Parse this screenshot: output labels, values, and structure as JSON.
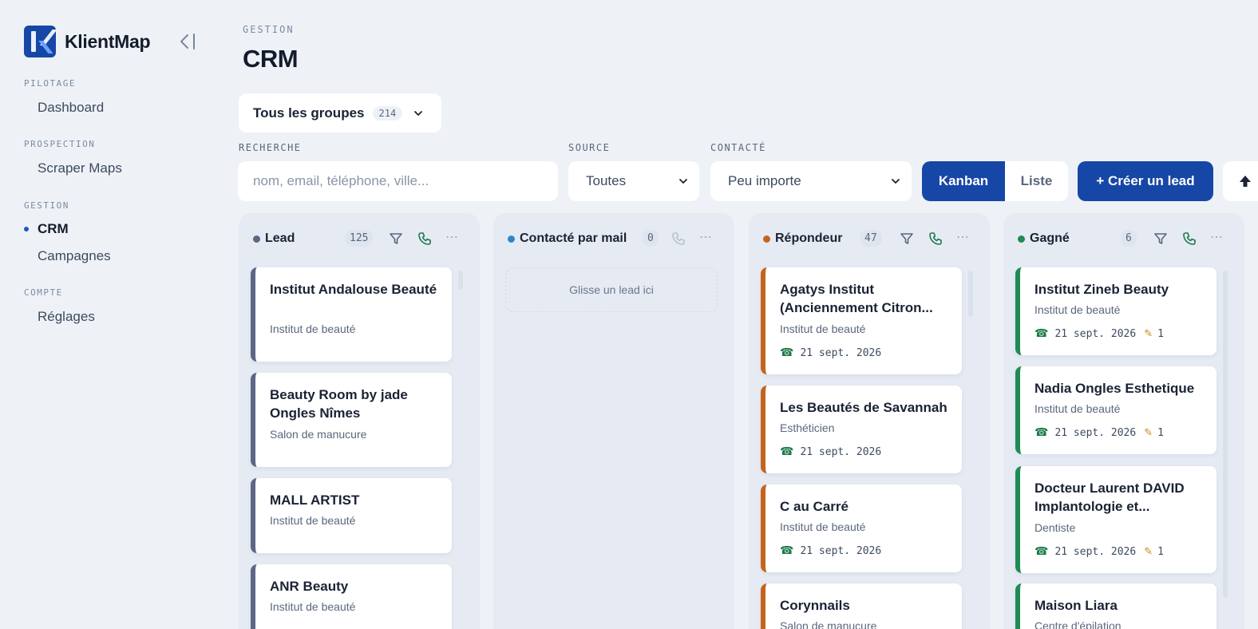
{
  "app": {
    "name": "KlientMap"
  },
  "sidebar": {
    "sections": [
      {
        "label": "PILOTAGE",
        "items": [
          {
            "label": "Dashboard"
          }
        ]
      },
      {
        "label": "PROSPECTION",
        "items": [
          {
            "label": "Scraper Maps"
          }
        ]
      },
      {
        "label": "GESTION",
        "items": [
          {
            "label": "CRM",
            "active": true
          },
          {
            "label": "Campagnes"
          }
        ]
      },
      {
        "label": "COMPTE",
        "items": [
          {
            "label": "Réglages"
          }
        ]
      }
    ]
  },
  "header": {
    "eyebrow": "GESTION",
    "title": "CRM"
  },
  "group_select": {
    "label": "Tous les groupes",
    "count": "214"
  },
  "filters": {
    "search": {
      "label": "RECHERCHE",
      "placeholder": "nom, email, téléphone, ville..."
    },
    "source": {
      "label": "SOURCE",
      "value": "Toutes"
    },
    "contacted": {
      "label": "CONTACTÉ",
      "value": "Peu importe"
    }
  },
  "view_toggle": {
    "kanban": "Kanban",
    "list": "Liste",
    "active": "kanban"
  },
  "actions": {
    "create_lead": "+ Créer un lead"
  },
  "colors": {
    "primary": "#1747a6",
    "lead": "#5b6783",
    "contacted": "#2f86c8",
    "responder": "#c6641c",
    "won": "#1f8a55"
  },
  "columns": [
    {
      "title": "Lead",
      "count": "125",
      "color": "#5b6783",
      "has_filter": true,
      "cards": [
        {
          "name": "Institut Andalouse Beauté",
          "category": "Institut de beauté"
        },
        {
          "name": "Beauty Room by jade Ongles Nîmes",
          "category": "Salon de manucure"
        },
        {
          "name": "MALL ARTIST",
          "category": "Institut de beauté"
        },
        {
          "name": "ANR Beauty",
          "category": "Institut de beauté"
        }
      ]
    },
    {
      "title": "Contacté par mail",
      "count": "0",
      "color": "#2f86c8",
      "has_filter": false,
      "empty_text": "Glisse un lead ici",
      "cards": []
    },
    {
      "title": "Répondeur",
      "count": "47",
      "color": "#c6641c",
      "has_filter": true,
      "cards": [
        {
          "name": "Agatys Institut (Anciennement Citron...",
          "category": "Institut de beauté",
          "date": "21 sept. 2026"
        },
        {
          "name": "Les Beautés de Savannah",
          "category": "Esthéticien",
          "date": "21 sept. 2026"
        },
        {
          "name": "C au Carré",
          "category": "Institut de beauté",
          "date": "21 sept. 2026"
        },
        {
          "name": "Corynnails",
          "category": "Salon de manucure"
        }
      ]
    },
    {
      "title": "Gagné",
      "count": "6",
      "color": "#1f8a55",
      "has_filter": true,
      "cards": [
        {
          "name": "Institut Zineb Beauty",
          "category": "Institut de beauté",
          "date": "21 sept. 2026",
          "notes": "1"
        },
        {
          "name": "Nadia Ongles Esthetique",
          "category": "Institut de beauté",
          "date": "21 sept. 2026",
          "notes": "1"
        },
        {
          "name": "Docteur Laurent DAVID Implantologie et...",
          "category": "Dentiste",
          "date": "21 sept. 2026",
          "notes": "1"
        },
        {
          "name": "Maison Liara",
          "category": "Centre d'épilation"
        }
      ]
    }
  ]
}
